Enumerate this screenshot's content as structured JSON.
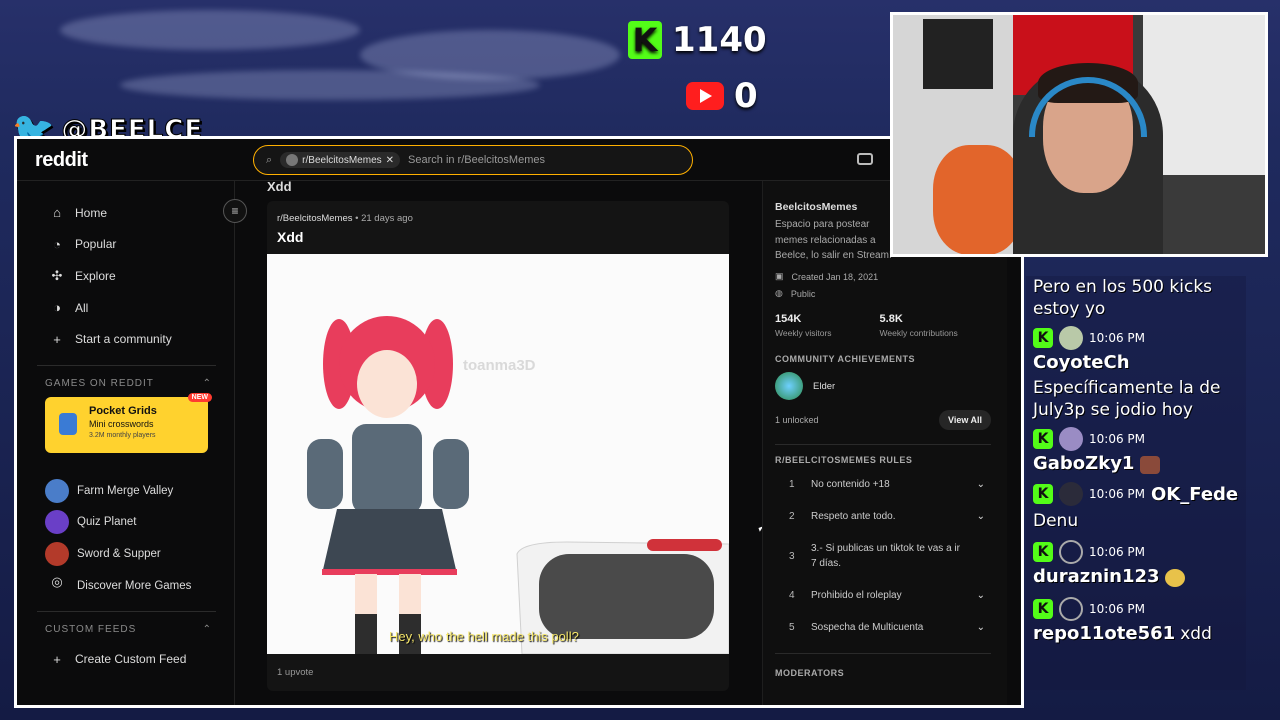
{
  "overlay": {
    "kick_count": "1140",
    "youtube_count": "0",
    "twitter_handle": "@BEELCE_"
  },
  "browser": {
    "logo": "reddit",
    "search": {
      "chip": "r/BeelcitosMemes",
      "placeholder": "Search in r/BeelcitosMemes"
    }
  },
  "leftnav": {
    "items": [
      {
        "label": "Home",
        "icon": "home-icon"
      },
      {
        "label": "Popular",
        "icon": "popular-icon"
      },
      {
        "label": "Explore",
        "icon": "explore-icon"
      },
      {
        "label": "All",
        "icon": "all-icon"
      },
      {
        "label": "Start a community",
        "icon": "plus-icon"
      }
    ],
    "games_heading": "GAMES ON REDDIT",
    "promo": {
      "title": "Pocket Grids",
      "subtitle": "Mini crosswords",
      "players": "3.2M monthly players",
      "badge": "NEW"
    },
    "games": [
      {
        "label": "Farm Merge Valley",
        "color": "#4a7dc9"
      },
      {
        "label": "Quiz Planet",
        "color": "#6a3fc7"
      },
      {
        "label": "Sword & Supper",
        "color": "#b33a2a"
      },
      {
        "label": "Discover More Games",
        "color": ""
      }
    ],
    "feeds_heading": "CUSTOM FEEDS",
    "create_feed": "Create Custom Feed"
  },
  "feed": {
    "top_title": "Xdd",
    "post": {
      "subreddit": "r/BeelcitosMemes",
      "age": "• 21 days ago",
      "title": "Xdd",
      "watermark": "toanma3D",
      "subtitle": "Hey, who the hell made this poll?",
      "upvotes": "1 upvote"
    }
  },
  "sidebar": {
    "name": "BeelcitosMemes",
    "description": "Espacio para postear memes relacionadas a Beelce, lo salir en Stream!",
    "created": "Created Jan 18, 2021",
    "visibility": "Public",
    "visitors_value": "154K",
    "visitors_label": "Weekly visitors",
    "contrib_value": "5.8K",
    "contrib_label": "Weekly contributions",
    "achievements_heading": "COMMUNITY ACHIEVEMENTS",
    "achievement": "Elder",
    "unlocked": "1 unlocked",
    "view_all": "View All",
    "rules_heading": "R/BEELCITOSMEMES RULES",
    "rules": [
      {
        "n": "1",
        "text": "No contenido +18"
      },
      {
        "n": "2",
        "text": "Respeto ante todo."
      },
      {
        "n": "3",
        "text": "3.- Si publicas un tiktok te vas a ir 7 días."
      },
      {
        "n": "4",
        "text": "Prohibido el roleplay"
      },
      {
        "n": "5",
        "text": "Sospecha de Multicuenta"
      }
    ],
    "moderators_heading": "MODERATORS"
  },
  "chat": {
    "first_text": "Pero en los 500 kicks estoy yo",
    "messages": [
      {
        "time": "10:06 PM",
        "user": "CoyoteCh",
        "text": "Específicamente la de July3p se jodio hoy",
        "inline": false
      },
      {
        "time": "10:06 PM",
        "user": "GaboZky1",
        "text": "",
        "inline": true
      },
      {
        "time": "10:06 PM",
        "user": "OK_Fede",
        "text": "Denu",
        "inline": false
      },
      {
        "time": "10:06 PM",
        "user": "duraznin123",
        "text": "",
        "inline": true
      },
      {
        "time": "10:06 PM",
        "user": "repo11ote561",
        "text": "xdd",
        "inline": true
      }
    ]
  }
}
